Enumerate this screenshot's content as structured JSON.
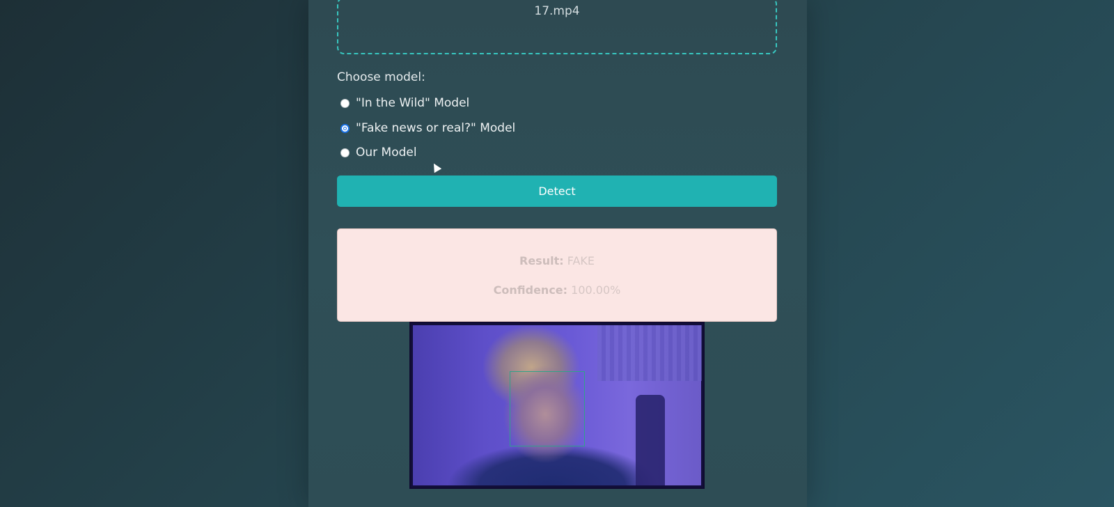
{
  "upload": {
    "filename": "17.mp4"
  },
  "model_select": {
    "label": "Choose model:",
    "options": [
      {
        "label": "\"In the Wild\" Model",
        "checked": false
      },
      {
        "label": "\"Fake news or real?\" Model",
        "checked": true
      },
      {
        "label": "Our Model",
        "checked": false
      }
    ]
  },
  "detect_button": {
    "label": "Detect"
  },
  "result": {
    "result_label": "Result:",
    "result_value": "FAKE",
    "confidence_label": "Confidence:",
    "confidence_value": "100.00%"
  },
  "colors": {
    "accent": "#20b2b2",
    "dropzone_border": "#38c7c0",
    "result_bg": "#fbe6e4",
    "face_box": "#2fa389"
  },
  "icons": {
    "cursor": "mouse-pointer-icon"
  }
}
